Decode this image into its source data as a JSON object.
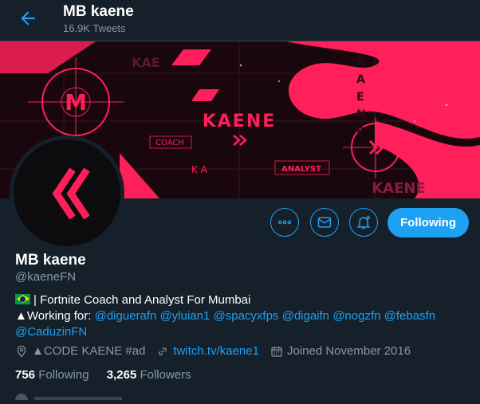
{
  "header": {
    "title": "MB kaene",
    "subtitle": "16.9K Tweets"
  },
  "banner": {
    "brand_text": "KAENE",
    "label_coach": "COACH",
    "label_analyst": "ANALYST",
    "side_letters": "KAENE",
    "bottom_text": "KAENE",
    "m_letter": "M",
    "ka_letters": "K A"
  },
  "actions": {
    "more_icon": "more-dots-icon",
    "message_icon": "envelope-icon",
    "notify_icon": "bell-plus-icon",
    "follow_label": "Following"
  },
  "profile": {
    "name": "MB kaene",
    "handle": "@kaeneFN",
    "bio_line1": "| Fortnite Coach and Analyst For Mumbai",
    "bio_working_prefix": "▲Working for: ",
    "mentions": [
      "@diguerafn",
      "@yluian1",
      "@spacyxfps",
      "@digaifn",
      "@nogzfn",
      "@febasfn",
      "@CaduzinFN"
    ],
    "location": "▲CODE KAENE #ad",
    "website": "twitch.tv/kaene1",
    "joined": "Joined November 2016"
  },
  "stats": {
    "following_count": "756",
    "following_label": "Following",
    "followers_count": "3,265",
    "followers_label": "Followers"
  },
  "colors": {
    "background": "#15202b",
    "accent": "#1da1f2",
    "banner_pink": "#ff1f5a",
    "muted": "#8899a6"
  }
}
